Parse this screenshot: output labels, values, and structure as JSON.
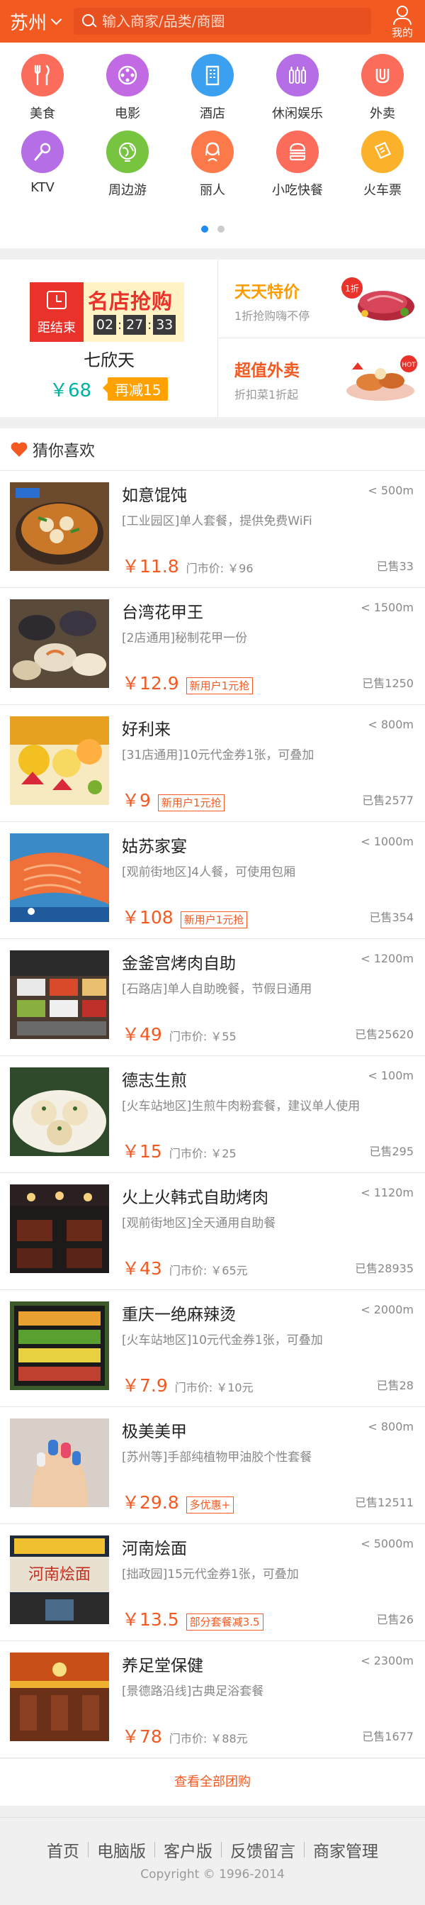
{
  "header": {
    "city": "苏州",
    "search_placeholder": "输入商家/品类/商圈",
    "mine_label": "我的"
  },
  "nav": {
    "items": [
      {
        "label": "美食",
        "icon": "fork-knife-icon",
        "color": "#fc6c5a"
      },
      {
        "label": "电影",
        "icon": "film-reel-icon",
        "color": "#c26ae4"
      },
      {
        "label": "酒店",
        "icon": "building-icon",
        "color": "#3ca0f0"
      },
      {
        "label": "休闲娱乐",
        "icon": "bottles-icon",
        "color": "#b56ee6"
      },
      {
        "label": "外卖",
        "icon": "takeout-icon",
        "color": "#fc6c5a"
      },
      {
        "label": "KTV",
        "icon": "microphone-icon",
        "color": "#b56ee6"
      },
      {
        "label": "周边游",
        "icon": "globe-icon",
        "color": "#76c440"
      },
      {
        "label": "丽人",
        "icon": "woman-icon",
        "color": "#fc7a4a"
      },
      {
        "label": "小吃快餐",
        "icon": "burger-icon",
        "color": "#fc6c5a"
      },
      {
        "label": "火车票",
        "icon": "ticket-icon",
        "color": "#fcb12a"
      }
    ],
    "page_count": 2,
    "active_page": 0
  },
  "promo": {
    "flash": {
      "countdown_label": "距结束",
      "title": "名店抢购",
      "hours": "02",
      "minutes": "27",
      "seconds": "33",
      "shop": "七欣天",
      "price": "￥68",
      "badge": "再减15"
    },
    "daily": {
      "title": "天天特价",
      "subtitle": "1折抢购嗨不停"
    },
    "takeout": {
      "title": "超值外卖",
      "subtitle": "折扣菜1折起"
    }
  },
  "guess": {
    "title": "猜你喜欢"
  },
  "deals": [
    {
      "name": "如意馄饨",
      "distance": "< 500m",
      "desc": "[工业园区]单人套餐，提供免费WiFi",
      "price": "￥11.8",
      "market": "门市价: ￥96",
      "tag": "",
      "sold": "已售33"
    },
    {
      "name": "台湾花甲王",
      "distance": "< 1500m",
      "desc": "[2店通用]秘制花甲一份",
      "price": "￥12.9",
      "market": "",
      "tag": "新用户1元抢",
      "sold": "已售1250"
    },
    {
      "name": "好利来",
      "distance": "< 800m",
      "desc": "[31店通用]10元代金券1张，可叠加",
      "price": "￥9",
      "market": "",
      "tag": "新用户1元抢",
      "sold": "已售2577"
    },
    {
      "name": "姑苏家宴",
      "distance": "< 1000m",
      "desc": "[观前街地区]4人餐，可使用包厢",
      "price": "￥108",
      "market": "",
      "tag": "新用户1元抢",
      "sold": "已售354"
    },
    {
      "name": "金釜宫烤肉自助",
      "distance": "< 1200m",
      "desc": "[石路店]单人自助晚餐，节假日通用",
      "price": "￥49",
      "market": "门市价: ￥55",
      "tag": "",
      "sold": "已售25620"
    },
    {
      "name": "德志生煎",
      "distance": "< 100m",
      "desc": "[火车站地区]生煎牛肉粉套餐，建议单人使用",
      "price": "￥15",
      "market": "门市价: ￥25",
      "tag": "",
      "sold": "已售295"
    },
    {
      "name": "火上火韩式自助烤肉",
      "distance": "< 1120m",
      "desc": "[观前街地区]全天通用自助餐",
      "price": "￥43",
      "market": "门市价: ￥65元",
      "tag": "",
      "sold": "已售28935"
    },
    {
      "name": "重庆一绝麻辣烫",
      "distance": "< 2000m",
      "desc": "[火车站地区]10元代金券1张，可叠加",
      "price": "￥7.9",
      "market": "门市价: ￥10元",
      "tag": "",
      "sold": "已售28"
    },
    {
      "name": "极美美甲",
      "distance": "< 800m",
      "desc": "[苏州等]手部纯植物甲油胶个性套餐",
      "price": "￥29.8",
      "market": "",
      "tag": "多优惠+",
      "sold": "已售12511"
    },
    {
      "name": "河南烩面",
      "distance": "< 5000m",
      "desc": "[拙政园]15元代金券1张，可叠加",
      "price": "￥13.5",
      "market": "",
      "tag": "部分套餐减3.5",
      "sold": "已售26"
    },
    {
      "name": "养足堂保健",
      "distance": "< 2300m",
      "desc": "[景德路沿线]古典足浴套餐",
      "price": "￥78",
      "market": "门市价: ￥88元",
      "tag": "",
      "sold": "已售1677"
    }
  ],
  "view_all": "查看全部团购",
  "footer": {
    "links": [
      "首页",
      "电脑版",
      "客户版",
      "反馈留言",
      "商家管理"
    ],
    "copyright": "Copyright © 1996-2014"
  },
  "colors": {
    "brand": "#f35a22",
    "teal": "#00b2a0",
    "orange": "#ffa200",
    "blue_dot": "#1e8cf0"
  }
}
